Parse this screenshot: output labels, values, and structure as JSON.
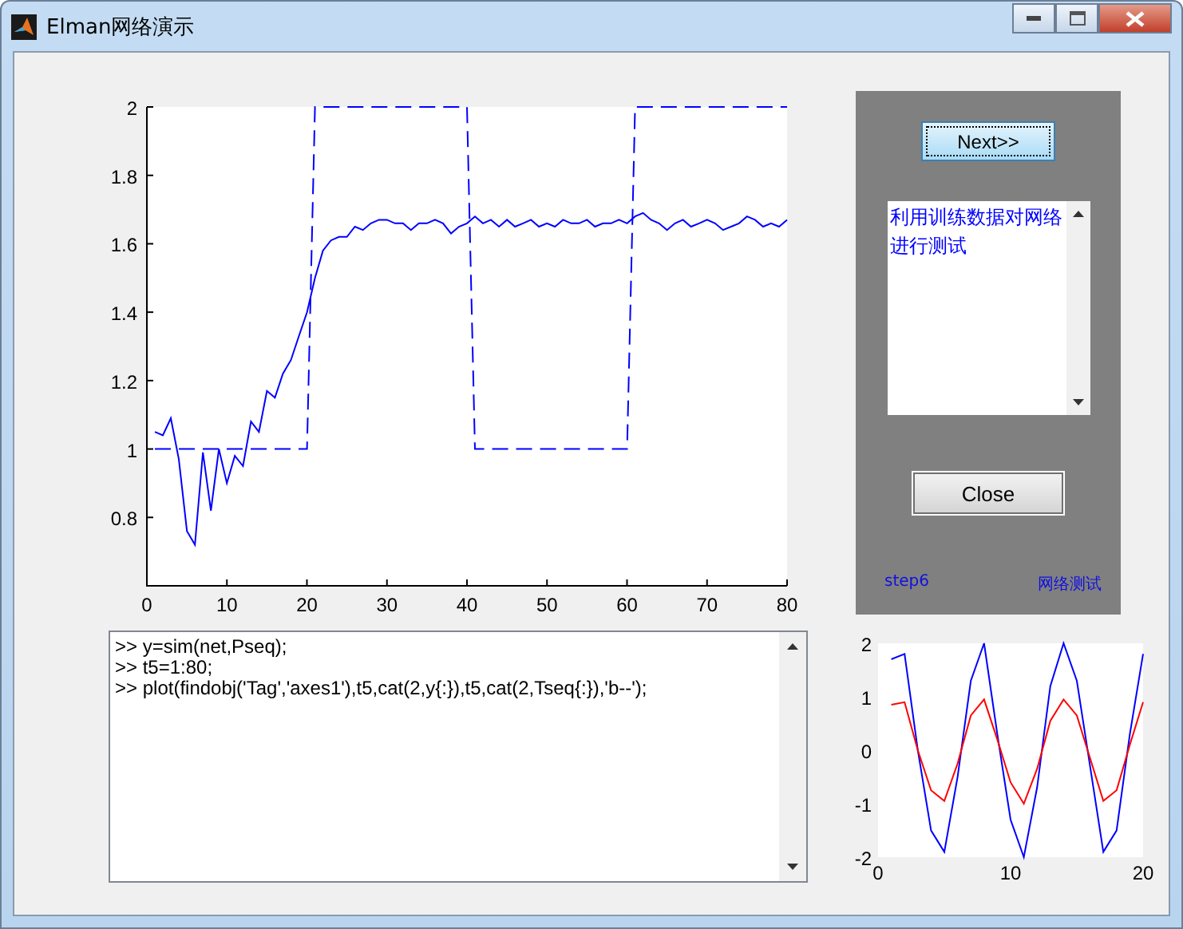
{
  "window": {
    "title": "Elman网络演示"
  },
  "main_chart": {
    "chart_data": {
      "type": "line",
      "x": [
        1,
        2,
        3,
        4,
        5,
        6,
        7,
        8,
        9,
        10,
        11,
        12,
        13,
        14,
        15,
        16,
        17,
        18,
        19,
        20,
        21,
        22,
        23,
        24,
        25,
        26,
        27,
        28,
        29,
        30,
        31,
        32,
        33,
        34,
        35,
        36,
        37,
        38,
        39,
        40,
        41,
        42,
        43,
        44,
        45,
        46,
        47,
        48,
        49,
        50,
        51,
        52,
        53,
        54,
        55,
        56,
        57,
        58,
        59,
        60,
        61,
        62,
        63,
        64,
        65,
        66,
        67,
        68,
        69,
        70,
        71,
        72,
        73,
        74,
        75,
        76,
        77,
        78,
        79,
        80
      ],
      "xlim": [
        0,
        80
      ],
      "ylim": [
        0.6,
        2
      ],
      "xticks": [
        0,
        10,
        20,
        30,
        40,
        50,
        60,
        70,
        80
      ],
      "yticks": [
        {
          "value": 0.8,
          "label": "0.8"
        },
        {
          "value": 1,
          "label": "1"
        },
        {
          "value": 1.2,
          "label": "1.2"
        },
        {
          "value": 1.4,
          "label": "1.4"
        },
        {
          "value": 1.6,
          "label": "1.6"
        },
        {
          "value": 1.8,
          "label": "1.8"
        },
        {
          "value": 2,
          "label": "2"
        }
      ],
      "series": [
        {
          "color": "#0000ff",
          "line_style": "solid",
          "values": [
            1.05,
            1.04,
            1.09,
            0.97,
            0.76,
            0.72,
            0.99,
            0.82,
            1.0,
            0.9,
            0.98,
            0.95,
            1.08,
            1.05,
            1.17,
            1.15,
            1.22,
            1.26,
            1.33,
            1.4,
            1.5,
            1.58,
            1.61,
            1.62,
            1.62,
            1.65,
            1.64,
            1.66,
            1.67,
            1.67,
            1.66,
            1.66,
            1.64,
            1.66,
            1.66,
            1.67,
            1.66,
            1.63,
            1.65,
            1.66,
            1.68,
            1.66,
            1.67,
            1.65,
            1.67,
            1.65,
            1.66,
            1.67,
            1.65,
            1.66,
            1.65,
            1.67,
            1.66,
            1.66,
            1.67,
            1.65,
            1.66,
            1.66,
            1.67,
            1.66,
            1.68,
            1.69,
            1.67,
            1.66,
            1.64,
            1.66,
            1.67,
            1.65,
            1.66,
            1.67,
            1.66,
            1.64,
            1.65,
            1.66,
            1.68,
            1.67,
            1.65,
            1.66,
            1.65,
            1.67
          ]
        },
        {
          "color": "#0000ff",
          "line_style": "dashed",
          "values": [
            1,
            1,
            1,
            1,
            1,
            1,
            1,
            1,
            1,
            1,
            1,
            1,
            1,
            1,
            1,
            1,
            1,
            1,
            1,
            1,
            2,
            2,
            2,
            2,
            2,
            2,
            2,
            2,
            2,
            2,
            2,
            2,
            2,
            2,
            2,
            2,
            2,
            2,
            2,
            2,
            1,
            1,
            1,
            1,
            1,
            1,
            1,
            1,
            1,
            1,
            1,
            1,
            1,
            1,
            1,
            1,
            1,
            1,
            1,
            1,
            2,
            2,
            2,
            2,
            2,
            2,
            2,
            2,
            2,
            2,
            2,
            2,
            2,
            2,
            2,
            2,
            2,
            2,
            2,
            2
          ]
        }
      ]
    }
  },
  "panel": {
    "next_button": "Next>>",
    "info_text": "利用训练数据对网络进行测试",
    "close_button": "Close",
    "step_label": "step6",
    "stage_label": "网络测试"
  },
  "console": {
    "lines": [
      ">> y=sim(net,Pseq);",
      ">> t5=1:80;",
      ">> plot(findobj('Tag','axes1'),t5,cat(2,y{:}),t5,cat(2,Tseq{:}),'b--');"
    ]
  },
  "small_chart": {
    "chart_data": {
      "type": "line",
      "x": [
        1,
        2,
        3,
        4,
        5,
        6,
        7,
        8,
        9,
        10,
        11,
        12,
        13,
        14,
        15,
        16,
        17,
        18,
        19,
        20
      ],
      "xlim": [
        0,
        20
      ],
      "ylim": [
        -2,
        2
      ],
      "xticks": [
        0,
        10,
        20
      ],
      "yticks": [
        {
          "value": -2,
          "label": "-2"
        },
        {
          "value": -1,
          "label": "-1"
        },
        {
          "value": 0,
          "label": "0"
        },
        {
          "value": 1,
          "label": "1"
        },
        {
          "value": 2,
          "label": "2"
        }
      ],
      "series": [
        {
          "color": "#0000ff",
          "line_style": "solid",
          "values": [
            1.7,
            1.8,
            0,
            -1.5,
            -1.9,
            -0.5,
            1.3,
            2,
            0.3,
            -1.3,
            -2,
            -0.7,
            1.2,
            2,
            1.3,
            -0.3,
            -1.9,
            -1.5,
            0.3,
            1.8
          ]
        },
        {
          "color": "#ff0000",
          "line_style": "solid",
          "values": [
            0.85,
            0.9,
            0,
            -0.75,
            -0.95,
            -0.25,
            0.65,
            0.95,
            0.2,
            -0.6,
            -1,
            -0.35,
            0.55,
            0.95,
            0.65,
            -0.15,
            -0.95,
            -0.75,
            0.1,
            0.9
          ]
        }
      ]
    }
  }
}
